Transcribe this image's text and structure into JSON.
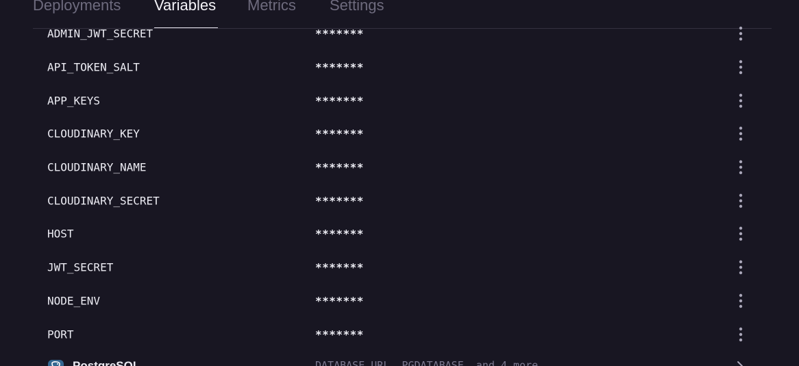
{
  "tabs": [
    {
      "label": "Deployments",
      "active": false
    },
    {
      "label": "Variables",
      "active": true
    },
    {
      "label": "Metrics",
      "active": false
    },
    {
      "label": "Settings",
      "active": false
    }
  ],
  "variables": [
    {
      "name": "ADMIN_JWT_SECRET",
      "value": "*******"
    },
    {
      "name": "API_TOKEN_SALT",
      "value": "*******"
    },
    {
      "name": "APP_KEYS",
      "value": "*******"
    },
    {
      "name": "CLOUDINARY_KEY",
      "value": "*******"
    },
    {
      "name": "CLOUDINARY_NAME",
      "value": "*******"
    },
    {
      "name": "CLOUDINARY_SECRET",
      "value": "*******"
    },
    {
      "name": "HOST",
      "value": "*******"
    },
    {
      "name": "JWT_SECRET",
      "value": "*******"
    },
    {
      "name": "NODE_ENV",
      "value": "*******"
    },
    {
      "name": "PORT",
      "value": "*******"
    }
  ],
  "plugin": {
    "name": "PostgreSQL",
    "variables_summary": "DATABASE_URL, PGDATABASE, and 4 more",
    "icon": "postgresql-elephant-icon"
  },
  "icons": {
    "row_menu": "kebab-menu-icon",
    "expand": "chevron-right-icon"
  },
  "colors": {
    "background": "#181622",
    "text": "#ececf3",
    "muted": "#6e6b7e",
    "divider": "#34313f"
  }
}
